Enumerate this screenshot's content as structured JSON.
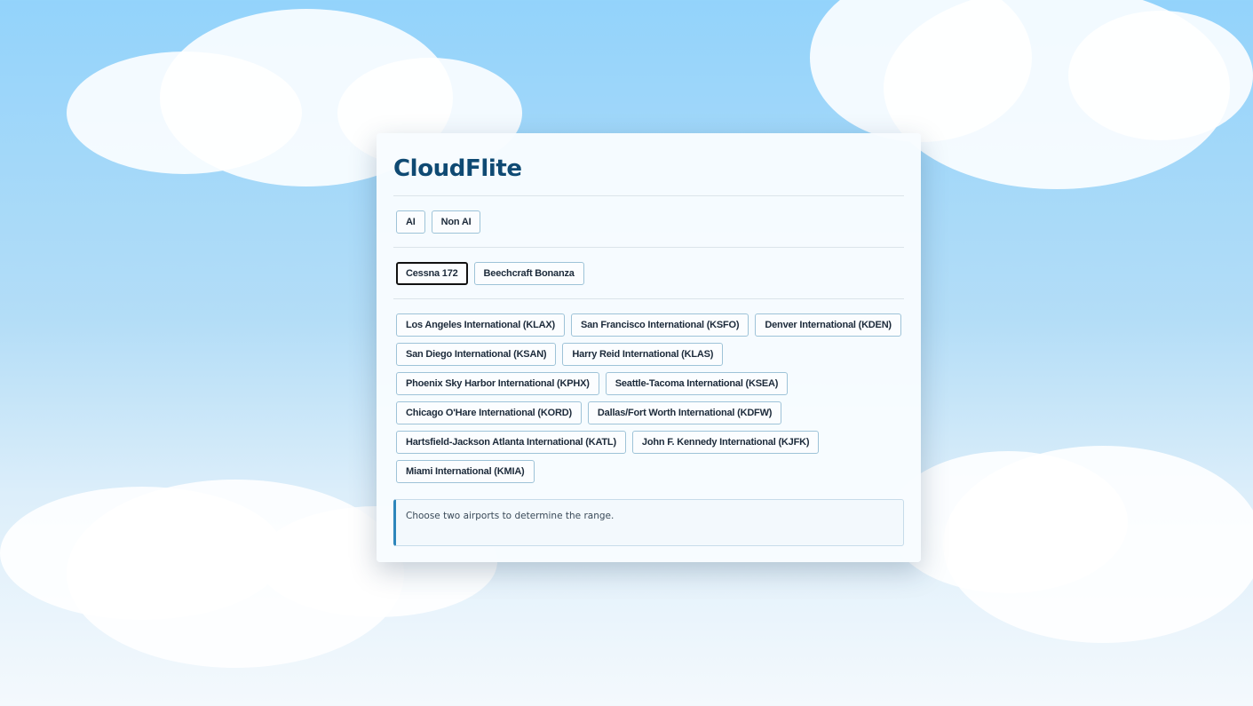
{
  "app": {
    "title": "CloudFlite"
  },
  "modes": [
    {
      "label": "AI",
      "selected": false
    },
    {
      "label": "Non AI",
      "selected": false
    }
  ],
  "aircraft": [
    {
      "label": "Cessna 172",
      "selected": true
    },
    {
      "label": "Beechcraft Bonanza",
      "selected": false
    }
  ],
  "airports": [
    "Los Angeles International (KLAX)",
    "San Francisco International (KSFO)",
    "Denver International (KDEN)",
    "San Diego International (KSAN)",
    "Harry Reid International (KLAS)",
    "Phoenix Sky Harbor International (KPHX)",
    "Seattle-Tacoma International (KSEA)",
    "Chicago O'Hare International (KORD)",
    "Dallas/Fort Worth International (KDFW)",
    "Hartsfield-Jackson Atlanta International (KATL)",
    "John F. Kennedy International (KJFK)",
    "Miami International (KMIA)"
  ],
  "info": {
    "message": "Choose two airports to determine the range."
  },
  "colors": {
    "accent": "#2d86bb",
    "title": "#0f4a73"
  }
}
